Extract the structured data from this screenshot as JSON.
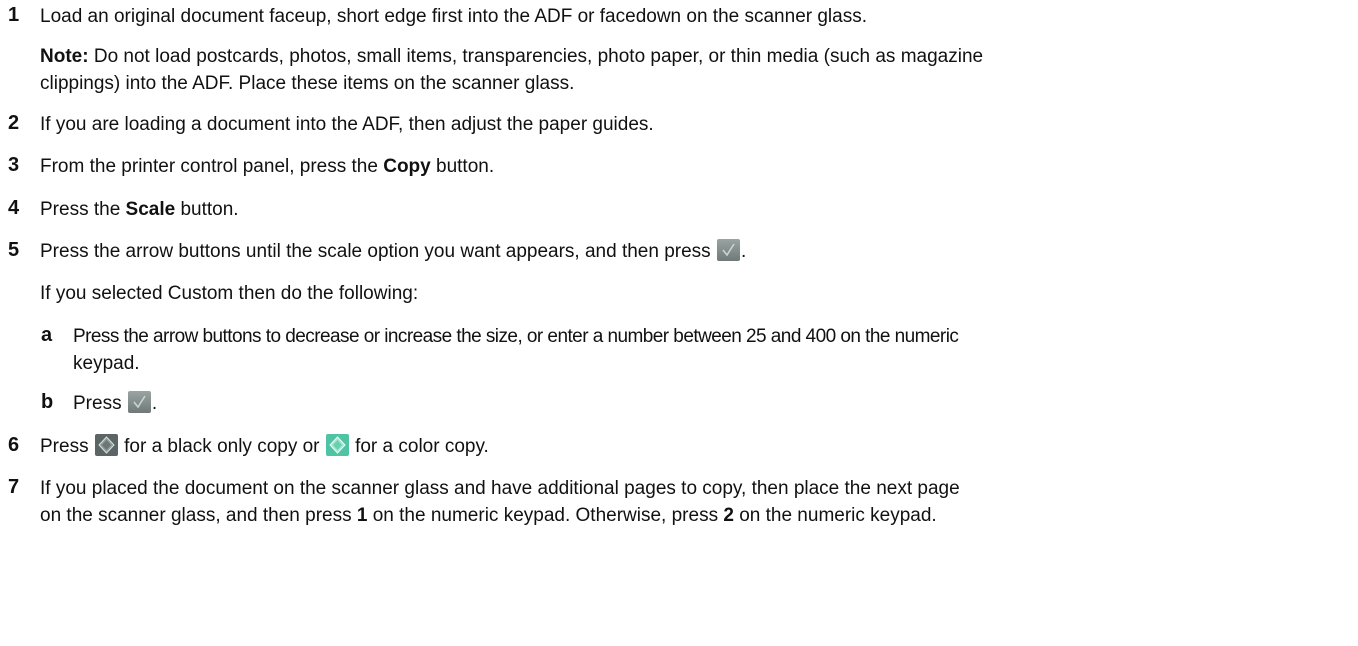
{
  "steps": [
    {
      "num": "1",
      "text": "Load an original document faceup, short edge first into the ADF or facedown on the scanner glass."
    },
    {
      "note_label": "Note:",
      "note_line1": "Do not load postcards, photos, small items, transparencies, photo paper, or thin media (such as magazine",
      "note_line2": "clippings) into the ADF. Place these items on the scanner glass."
    },
    {
      "num": "2",
      "text": "If you are loading a document into the ADF, then adjust the paper guides."
    },
    {
      "num": "3",
      "before": "From the printer control panel, press the ",
      "bold": "Copy",
      "after": " button."
    },
    {
      "num": "4",
      "before": "Press the ",
      "bold": "Scale",
      "after": " button."
    },
    {
      "num": "5",
      "before": "Press the arrow buttons until the scale option you want appears, and then press ",
      "after": "."
    },
    {
      "custom_text": "If you selected Custom then do the following:"
    },
    {
      "sub": "a",
      "line1": "Press the arrow buttons to decrease or increase the size, or enter a number between 25 and 400 on the numeric",
      "line2": "keypad."
    },
    {
      "sub": "b",
      "before": "Press ",
      "after": "."
    },
    {
      "num": "6",
      "before": "Press ",
      "middle": " for a black only copy or ",
      "after": " for a color copy."
    },
    {
      "num": "7",
      "line1": "If you placed the document on the scanner glass and have additional pages to copy, then place the next page",
      "line2_a": "on the scanner glass, and then press ",
      "line2_b1": "1",
      "line2_c": " on the numeric keypad. Otherwise, press ",
      "line2_b2": "2",
      "line2_d": " on the numeric keypad."
    }
  ],
  "icons": {
    "select": "checkmark-select-icon",
    "start_black": "start-black-icon",
    "start_color": "start-color-icon"
  },
  "colors": {
    "text": "#111111",
    "select_bg": "#7f8a88",
    "start_black_bg": "#606a6a",
    "start_color_bg": "#55c8a8"
  }
}
